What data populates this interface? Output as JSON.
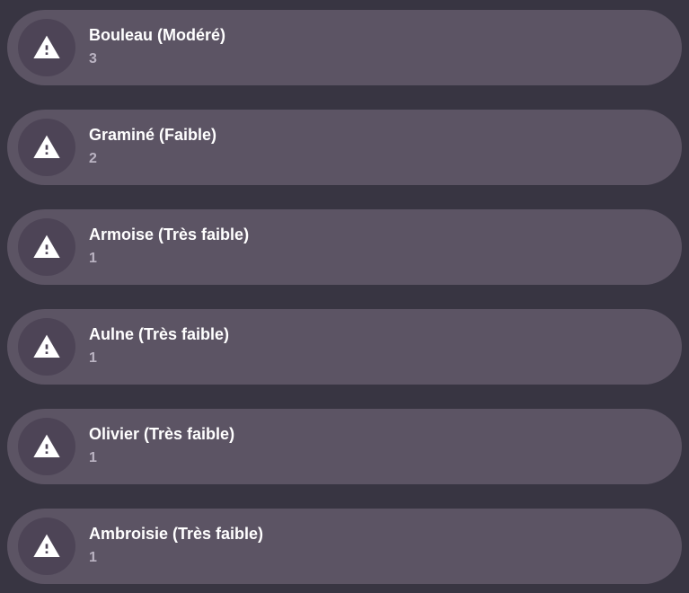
{
  "pollen": [
    {
      "name": "Bouleau (Modéré)",
      "value": "3",
      "icon": "alert-triangle-icon"
    },
    {
      "name": "Graminé (Faible)",
      "value": "2",
      "icon": "alert-triangle-icon"
    },
    {
      "name": "Armoise (Très faible)",
      "value": "1",
      "icon": "alert-triangle-icon"
    },
    {
      "name": "Aulne (Très faible)",
      "value": "1",
      "icon": "alert-triangle-icon"
    },
    {
      "name": "Olivier (Très faible)",
      "value": "1",
      "icon": "alert-triangle-icon"
    },
    {
      "name": "Ambroisie (Très faible)",
      "value": "1",
      "icon": "alert-triangle-icon"
    }
  ],
  "colors": {
    "background": "#383542",
    "card": "#5c5464",
    "icon_circle": "#4d4456",
    "title": "#ffffff",
    "value": "#bab3c2"
  }
}
